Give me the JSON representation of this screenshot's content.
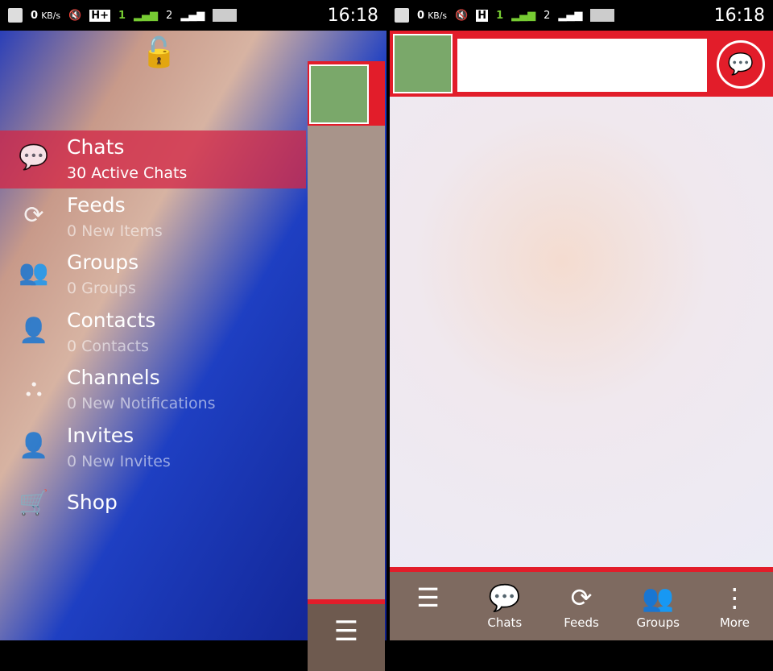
{
  "status_left": {
    "speed": "0",
    "speed_unit": "KB/s",
    "network": "H+",
    "sim1": "1",
    "sim2": "2",
    "time": "16:18"
  },
  "status_right": {
    "speed": "0",
    "speed_unit": "KB/s",
    "network": "H",
    "sim1": "1",
    "sim2": "2",
    "time": "16:18"
  },
  "drawer": {
    "items": [
      {
        "title": "Chats",
        "subtitle": "30 Active Chats",
        "icon": "bbm-chat-icon",
        "active": true
      },
      {
        "title": "Feeds",
        "subtitle": "0 New Items",
        "icon": "refresh-icon"
      },
      {
        "title": "Groups",
        "subtitle": "0 Groups",
        "icon": "groups-icon"
      },
      {
        "title": "Contacts",
        "subtitle": "0 Contacts",
        "icon": "contact-icon"
      },
      {
        "title": "Channels",
        "subtitle": "0 New Notifications",
        "icon": "channels-icon"
      },
      {
        "title": "Invites",
        "subtitle": "0 New Invites",
        "icon": "add-contact-icon"
      },
      {
        "title": "Shop",
        "subtitle": "",
        "icon": "cart-icon"
      }
    ]
  },
  "search": {
    "value": ""
  },
  "tabs": [
    {
      "label": "",
      "icon": "menu-icon"
    },
    {
      "label": "Chats",
      "icon": "bbm-chat-icon",
      "active": true
    },
    {
      "label": "Feeds",
      "icon": "refresh-icon"
    },
    {
      "label": "Groups",
      "icon": "groups-icon"
    },
    {
      "label": "More",
      "icon": "more-icon"
    }
  ],
  "colors": {
    "accent": "#e21d2a"
  }
}
